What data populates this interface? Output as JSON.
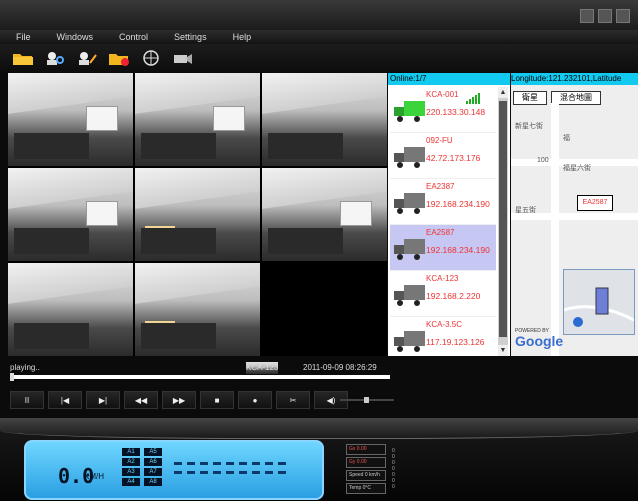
{
  "menu": [
    "File",
    "Windows",
    "Control",
    "Settings",
    "Help"
  ],
  "toolbar": [
    "open-folder-icon",
    "user-search-icon",
    "user-edit-icon",
    "folder-delete-icon",
    "network-icon",
    "camera-icon"
  ],
  "online": "Online:1/7",
  "coords": "Longitude:121.232101,Latitude",
  "map_buttons": [
    "衛星",
    "混合地圖"
  ],
  "map_labels": [
    "新星七街",
    "福星六街",
    "星五街",
    "EA2587",
    "福",
    "100",
    "POWERED BY",
    "Google"
  ],
  "vehicles": [
    {
      "name": "KCA-001",
      "ip": "220.133.30.148"
    },
    {
      "name": "092-FU",
      "ip": "42.72.173.176"
    },
    {
      "name": "EA2387",
      "ip": "192.168.234.190"
    },
    {
      "name": "EA2587",
      "ip": "192.168.234.190"
    },
    {
      "name": "KCA-123",
      "ip": "192.168.2.220"
    },
    {
      "name": "KCA-3.5C",
      "ip": "117.19.123.126"
    }
  ],
  "status": {
    "state": "playing..",
    "camera": "KCA-123",
    "datetime": "2011-09-09 08:26:29"
  },
  "controls": [
    "II",
    "|◀",
    "▶|",
    "◀◀",
    "▶▶",
    "■",
    "●",
    "✂",
    "◀)"
  ],
  "dash": {
    "speed": "0.0",
    "unit": "KM/H",
    "lcd": [
      "A1",
      "A5",
      "A2",
      "A6",
      "A3",
      "A7",
      "A4",
      "A8"
    ],
    "gauge": [
      "Gx 0.00",
      "Gy 0.00",
      "Speed 0 km/h",
      "Temp 0°C"
    ]
  }
}
